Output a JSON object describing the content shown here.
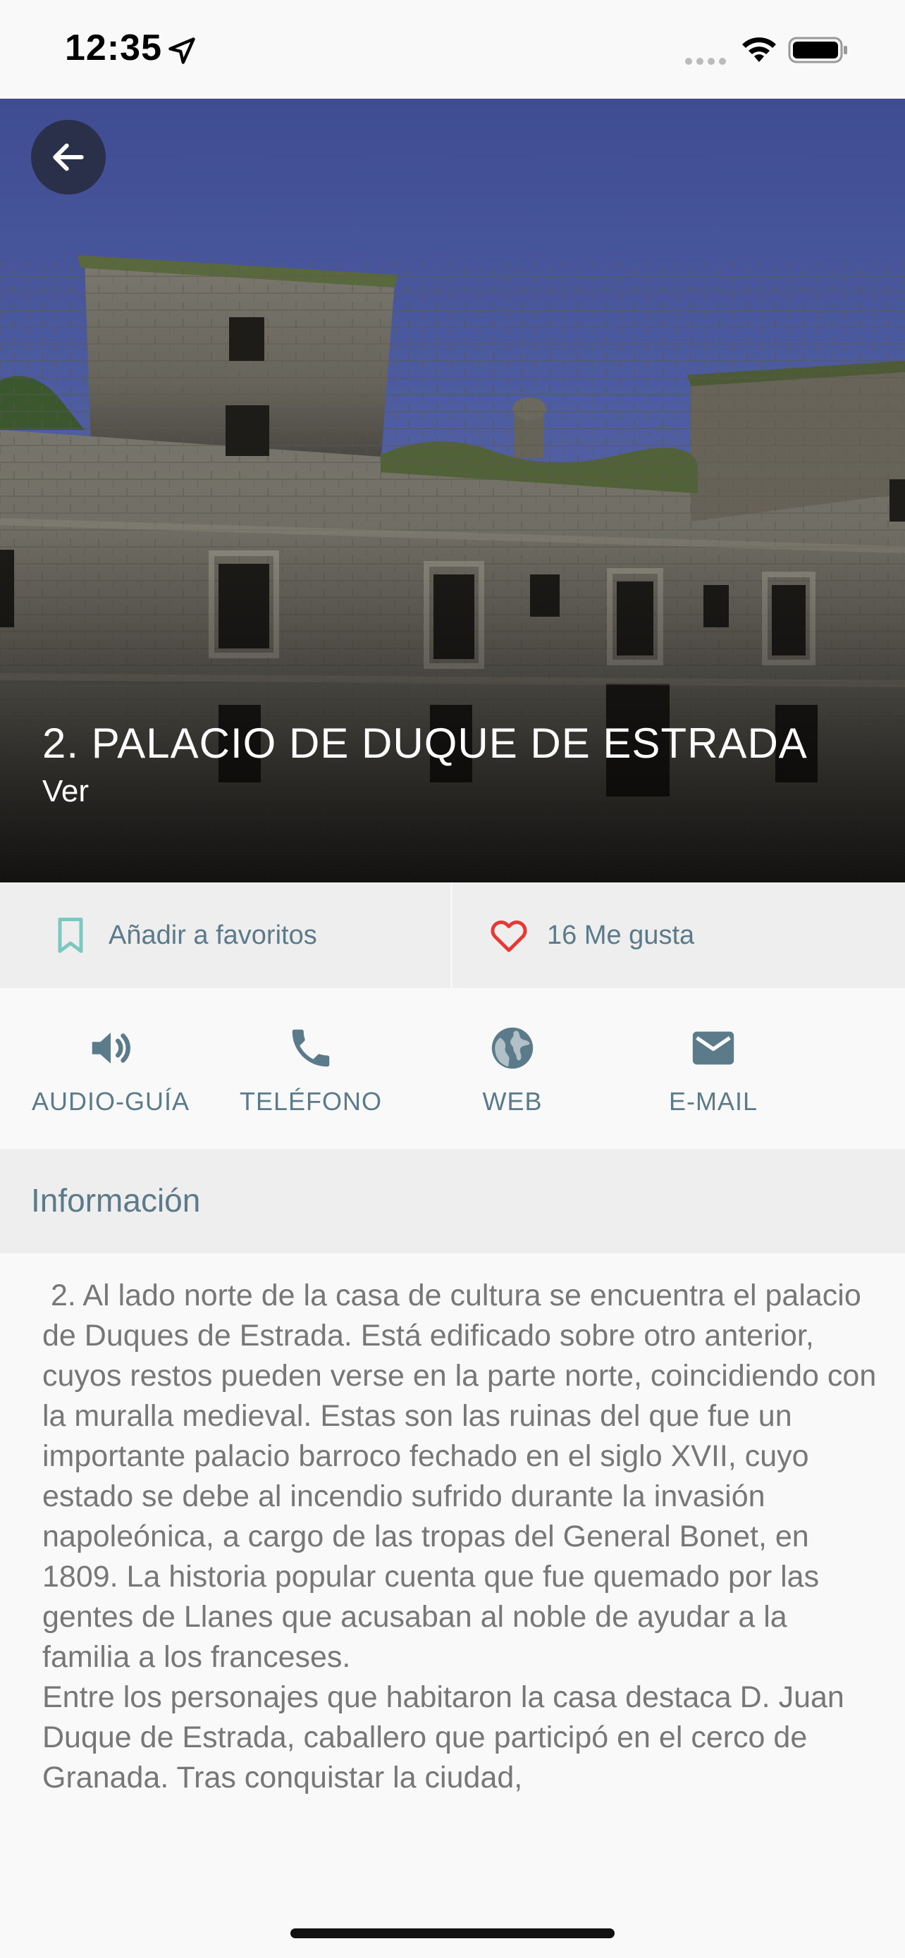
{
  "status_bar": {
    "time": "12:35"
  },
  "hero": {
    "title": "2. PALACIO DE DUQUE DE ESTRADA",
    "subtitle": "Ver"
  },
  "actions": {
    "favorites_label": "Añadir a favoritos",
    "likes_label": "16 Me gusta"
  },
  "contact": {
    "items": [
      {
        "label": "AUDIO-GUÍA",
        "icon": "speaker-icon"
      },
      {
        "label": "TELÉFONO",
        "icon": "phone-icon"
      },
      {
        "label": "WEB",
        "icon": "globe-icon"
      },
      {
        "label": "E-MAIL",
        "icon": "mail-icon"
      }
    ]
  },
  "info": {
    "header": "Información",
    "paragraphs": [
      " 2. Al lado norte de la casa de cultura se encuentra el palacio de Duques de Estrada. Está edificado sobre otro anterior, cuyos restos pueden verse en la parte norte, coincidiendo con la muralla medieval. Estas son las ruinas del que fue un importante palacio barroco fechado en el siglo XVII, cuyo estado se debe al incendio sufrido durante la invasión napoleónica, a cargo de las tropas del General Bonet, en 1809. La historia popular cuenta que fue quemado por las gentes de Llanes que acusaban al noble de ayudar a la familia a los franceses.",
      "Entre los personajes que habitaron la casa destaca D. Juan Duque de Estrada, caballero que participó en el cerco de Granada. Tras conquistar la ciudad,"
    ]
  },
  "colors": {
    "accent_teal": "#7cc8c0",
    "heart_red": "#e53935",
    "icon_blue_gray": "#5b7a8a"
  }
}
